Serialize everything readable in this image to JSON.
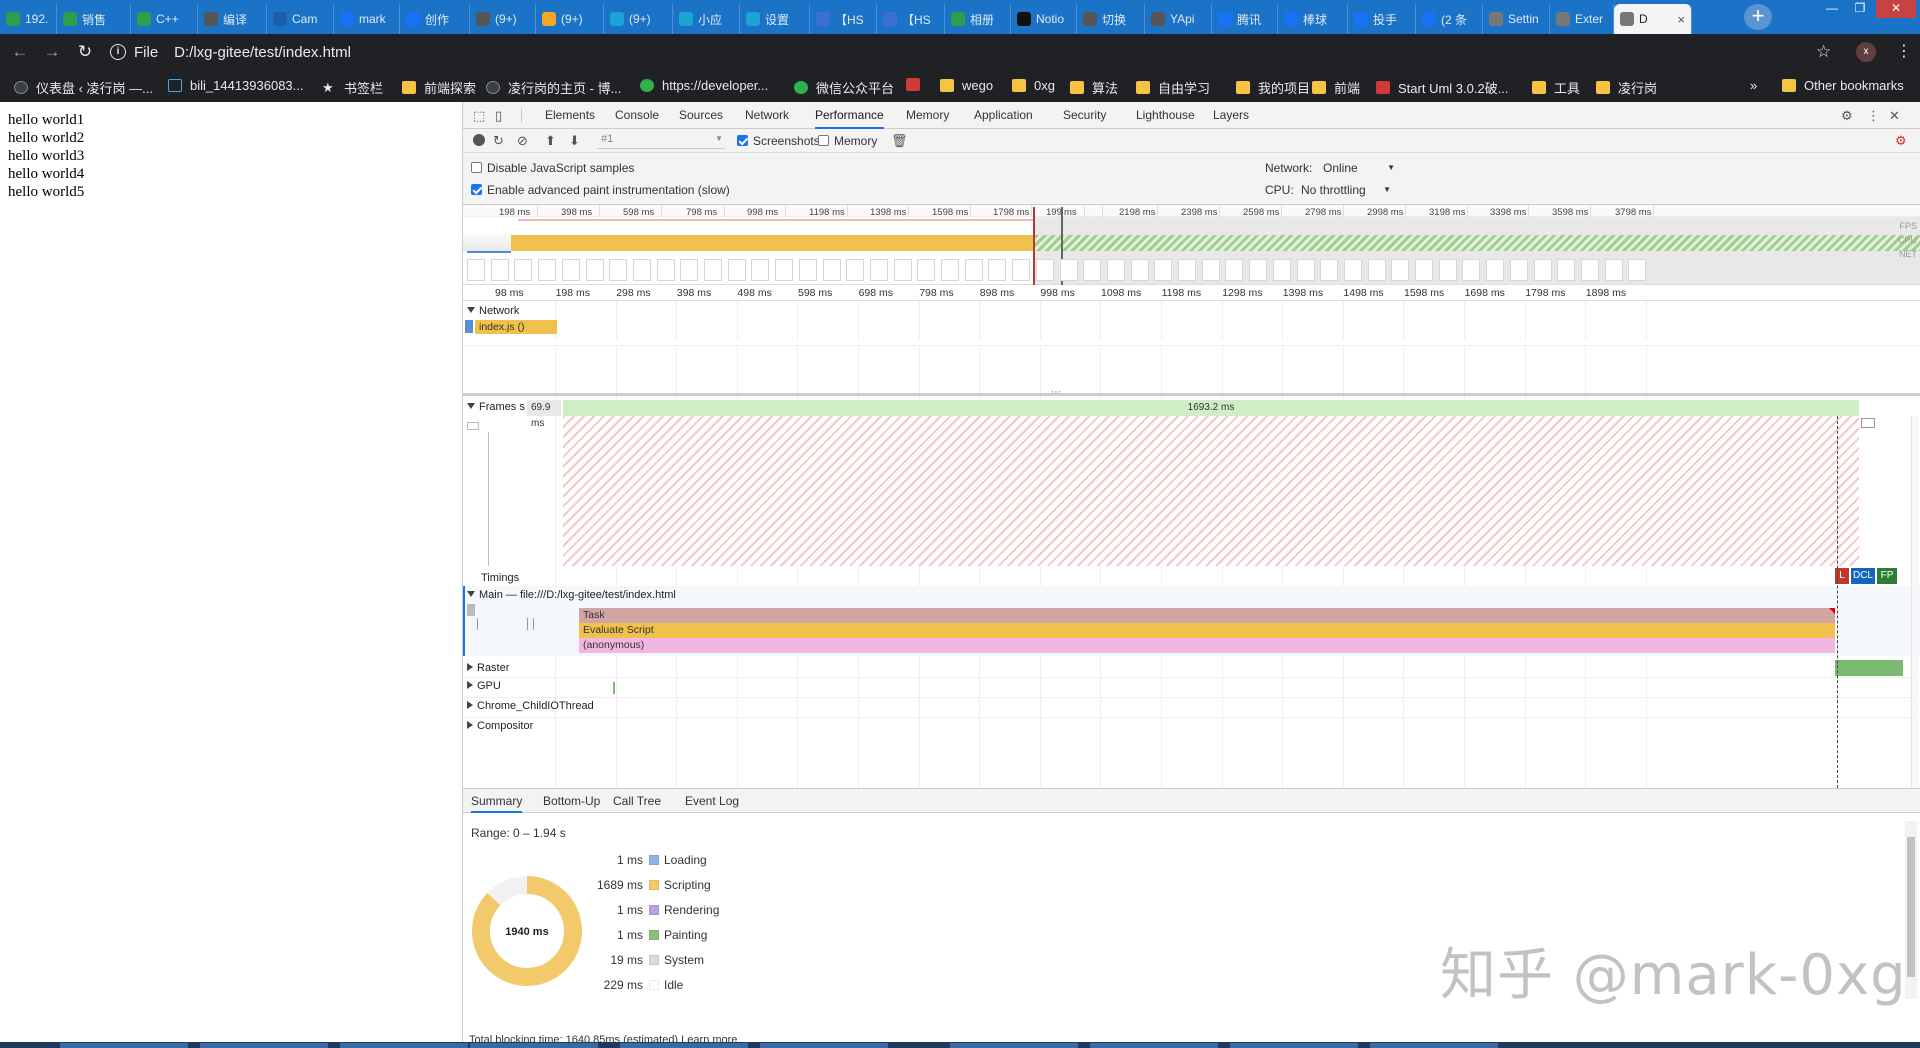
{
  "browser": {
    "tabs": [
      {
        "label": "192.",
        "color": "#2e9e4a"
      },
      {
        "label": "销售",
        "color": "#2e9e4a"
      },
      {
        "label": "C++",
        "color": "#2e9e4a"
      },
      {
        "label": "编译",
        "color": "#555555"
      },
      {
        "label": "Cam",
        "color": "#1d5fa8"
      },
      {
        "label": "mark",
        "color": "#1772f6"
      },
      {
        "label": "创作",
        "color": "#1772f6"
      },
      {
        "label": "(9+)",
        "color": "#555555"
      },
      {
        "label": "(9+)",
        "color": "#f5a623"
      },
      {
        "label": "(9+)",
        "color": "#1aa3d4"
      },
      {
        "label": "小应",
        "color": "#1aa3d4"
      },
      {
        "label": "设置",
        "color": "#1aa3d4"
      },
      {
        "label": "【HS",
        "color": "#3b6fd1"
      },
      {
        "label": "【HS",
        "color": "#3b6fd1"
      },
      {
        "label": "相册",
        "color": "#2e9e4a"
      },
      {
        "label": "Notio",
        "color": "#111111"
      },
      {
        "label": "切换",
        "color": "#555555"
      },
      {
        "label": "YApi",
        "color": "#555555"
      },
      {
        "label": "腾讯",
        "color": "#1772f6"
      },
      {
        "label": "棒球",
        "color": "#1772f6"
      },
      {
        "label": "投手",
        "color": "#1772f6"
      },
      {
        "label": "(2 条",
        "color": "#1772f6"
      },
      {
        "label": "Settin",
        "color": "#777777"
      },
      {
        "label": "Exter",
        "color": "#777777"
      },
      {
        "label": "D",
        "color": "#777777"
      }
    ],
    "active_tab_close": "×",
    "new_tab": "+",
    "url_scheme": "File",
    "url": "D:/lxg-gitee/test/index.html",
    "profile_initial": "x",
    "bookmarks": [
      {
        "label": "仪表盘 ‹ 凌行岗 —...",
        "kind": "site"
      },
      {
        "label": "bili_14413936083...",
        "kind": "tv"
      },
      {
        "label": "书签栏",
        "kind": "star"
      },
      {
        "label": "前端探索",
        "kind": "folder"
      },
      {
        "label": "凌行岗的主页 - 博...",
        "kind": "site"
      },
      {
        "label": "https://developer...",
        "kind": "wechat"
      },
      {
        "label": "微信公众平台",
        "kind": "wechat"
      },
      {
        "label": "",
        "kind": "red"
      },
      {
        "label": "wego",
        "kind": "folder"
      },
      {
        "label": "0xg",
        "kind": "folder"
      },
      {
        "label": "算法",
        "kind": "folder"
      },
      {
        "label": "自由学习",
        "kind": "folder"
      },
      {
        "label": "我的项目",
        "kind": "folder"
      },
      {
        "label": "前端",
        "kind": "folder"
      },
      {
        "label": "Start Uml 3.0.2破...",
        "kind": "red"
      },
      {
        "label": "工具",
        "kind": "folder"
      },
      {
        "label": "凌行岗",
        "kind": "folder"
      }
    ],
    "bookmarks_more": "»",
    "other_bookmarks": "Other bookmarks"
  },
  "page": {
    "lines": [
      "hello world1",
      "hello world2",
      "hello world3",
      "hello world4",
      "hello world5"
    ]
  },
  "devtools": {
    "tabs": [
      "Elements",
      "Console",
      "Sources",
      "Network",
      "Performance",
      "Memory",
      "Application",
      "Security",
      "Lighthouse",
      "Layers"
    ],
    "active_tab": "Performance",
    "recording_select": "#1",
    "screenshots_label": "Screenshots",
    "memory_label": "Memory",
    "disable_js_samples": "Disable JavaScript samples",
    "enable_paint": "Enable advanced paint instrumentation (slow)",
    "network_label": "Network:",
    "network_value": "Online",
    "cpu_label": "CPU:",
    "cpu_value": "No throttling",
    "overview_ticks": [
      "198 ms",
      "398 ms",
      "598 ms",
      "798 ms",
      "998 ms",
      "1198 ms",
      "1398 ms",
      "1598 ms",
      "1798 ms",
      "199",
      "ms",
      "2198 ms",
      "2398 ms",
      "2598 ms",
      "2798 ms",
      "2998 ms",
      "3198 ms",
      "3398 ms",
      "3598 ms",
      "3798 ms"
    ],
    "overview_side": [
      "FPS",
      "CPU",
      "NET"
    ],
    "main_ticks": [
      "98 ms",
      "198 ms",
      "298 ms",
      "398 ms",
      "498 ms",
      "598 ms",
      "698 ms",
      "798 ms",
      "898 ms",
      "998 ms",
      "1098 ms",
      "1198 ms",
      "1298 ms",
      "1398 ms",
      "1498 ms",
      "1598 ms",
      "1698 ms",
      "1798 ms",
      "1898 ms"
    ],
    "network_track": "Network",
    "network_item": "index.js ()",
    "frames_track": "Frames",
    "frames_s": "s",
    "frame_short": "69.9 ms",
    "frame_long": "1693.2 ms",
    "timings_track": "Timings",
    "timing_markers": [
      "L",
      "DCL",
      "FP"
    ],
    "main_track": "Main — file:///D:/lxg-gitee/test/index.html",
    "flame": [
      "Task",
      "Evaluate Script",
      "(anonymous)"
    ],
    "tracks": [
      "Raster",
      "GPU",
      "Chrome_ChildIOThread",
      "Compositor"
    ],
    "bottom_tabs": [
      "Summary",
      "Bottom-Up",
      "Call Tree",
      "Event Log"
    ],
    "range": "Range: 0 – 1.94 s",
    "total": "1940 ms",
    "summary": [
      {
        "value": "1 ms",
        "label": "Loading",
        "color": "#8cb4e0"
      },
      {
        "value": "1689 ms",
        "label": "Scripting",
        "color": "#f2ca6b"
      },
      {
        "value": "1 ms",
        "label": "Rendering",
        "color": "#b99fe6"
      },
      {
        "value": "1 ms",
        "label": "Painting",
        "color": "#8bc07a"
      },
      {
        "value": "19 ms",
        "label": "System",
        "color": "#dadada"
      },
      {
        "value": "229 ms",
        "label": "Idle",
        "color": "#ffffff"
      }
    ],
    "tbt_text": "Total blocking time: 1640.85ms (estimated)",
    "learn_more": "Learn more"
  },
  "watermark": "知乎 @mark-0xg"
}
